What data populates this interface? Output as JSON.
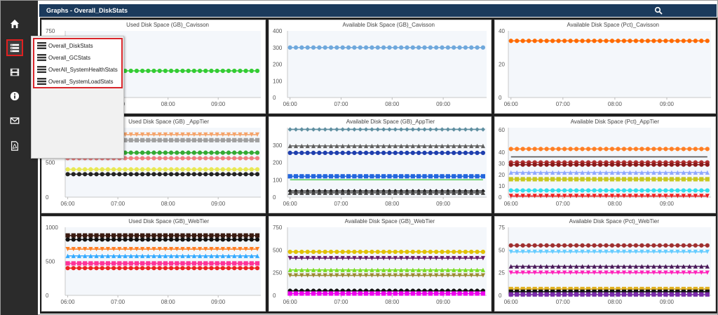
{
  "header": {
    "title": "Graphs - Overall_DiskStats",
    "search_icon": "search-icon"
  },
  "sidebar": {
    "items": [
      {
        "name": "home",
        "icon": "home-icon"
      },
      {
        "name": "graphs",
        "icon": "graph-list-icon",
        "selected": true
      },
      {
        "name": "media",
        "icon": "film-icon"
      },
      {
        "name": "info",
        "icon": "info-icon"
      },
      {
        "name": "mail",
        "icon": "mail-icon"
      },
      {
        "name": "pdf",
        "icon": "pdf-icon"
      }
    ]
  },
  "menu": {
    "items": [
      {
        "label": "Overall_DiskStats"
      },
      {
        "label": "Overall_GCStats"
      },
      {
        "label": "OverAll_SystemHealthStats"
      },
      {
        "label": "Overall_SystemLoadStats"
      }
    ]
  },
  "x_ticks": [
    "06:00",
    "07:00",
    "08:00",
    "09:00"
  ],
  "colors": {
    "sidebar_bg": "#2b2b2b",
    "header_bg": "#1b3a5c",
    "menu_border": "#d8262c"
  },
  "chart_data": [
    {
      "type": "line",
      "title": "Used Disk Space (GB)_Cavisson",
      "ylim": [
        0,
        750
      ],
      "y_ticks": [
        "750"
      ],
      "series": [
        {
          "values": [
            300
          ],
          "color": "#33cc33",
          "marker": "circle"
        }
      ]
    },
    {
      "type": "line",
      "title": "Available Disk Space (GB)_Cavisson",
      "ylim": [
        0,
        400
      ],
      "y_ticks": [
        "0",
        "100",
        "200",
        "300",
        "400"
      ],
      "series": [
        {
          "values": [
            300
          ],
          "color": "#6fa8dc",
          "marker": "circle"
        }
      ]
    },
    {
      "type": "line",
      "title": "Available Disk Space (Pct)_Cavisson",
      "ylim": [
        0,
        40
      ],
      "y_ticks": [
        "0",
        "20",
        "40"
      ],
      "series": [
        {
          "values": [
            34
          ],
          "color": "#ff6a00",
          "marker": "circle"
        }
      ]
    },
    {
      "type": "line",
      "title": "Used Disk Space (GB) _AppTier",
      "ylim": [
        0,
        1000
      ],
      "y_ticks": [
        "0",
        "500"
      ],
      "series": [
        {
          "values": [
            900
          ],
          "color": "#f5a36a",
          "marker": "triangle-down"
        },
        {
          "values": [
            820
          ],
          "color": "#a0a0a0",
          "marker": "square"
        },
        {
          "values": [
            640
          ],
          "color": "#33aa33",
          "marker": "circle"
        },
        {
          "values": [
            560
          ],
          "color": "#f08080",
          "marker": "circle"
        },
        {
          "values": [
            400
          ],
          "color": "#e8e855",
          "marker": "circle"
        },
        {
          "values": [
            330
          ],
          "color": "#222222",
          "marker": "circle"
        }
      ]
    },
    {
      "type": "line",
      "title": "Available Disk Space (GB)_AppTier",
      "ylim": [
        0,
        400
      ],
      "y_ticks": [
        "0",
        "100",
        "200",
        "300"
      ],
      "series": [
        {
          "values": [
            390
          ],
          "color": "#5f8fa0",
          "marker": "diamond"
        },
        {
          "values": [
            295
          ],
          "color": "#606060",
          "marker": "triangle"
        },
        {
          "values": [
            255
          ],
          "color": "#1f3fae",
          "marker": "circle"
        },
        {
          "values": [
            120
          ],
          "color": "#2266dd",
          "marker": "square"
        },
        {
          "values": [
            100
          ],
          "color": "#55cc55",
          "marker": "none"
        },
        {
          "values": [
            35
          ],
          "color": "#222222",
          "marker": "diamond"
        },
        {
          "values": [
            25
          ],
          "color": "#444444",
          "marker": "triangle"
        }
      ]
    },
    {
      "type": "line",
      "title": "Available Disk Space (Pct)_AppTier",
      "ylim": [
        0,
        62
      ],
      "y_ticks": [
        "0",
        "10",
        "20",
        "30",
        "40",
        "60"
      ],
      "series": [
        {
          "values": [
            43
          ],
          "color": "#ff7f24",
          "marker": "circle"
        },
        {
          "values": [
            36
          ],
          "color": "#555555",
          "marker": "none"
        },
        {
          "values": [
            31
          ],
          "color": "#b03030",
          "marker": "circle"
        },
        {
          "values": [
            29
          ],
          "color": "#8b1a1a",
          "marker": "circle"
        },
        {
          "values": [
            22
          ],
          "color": "#8fa8ff",
          "marker": "triangle"
        },
        {
          "values": [
            16
          ],
          "color": "#c8c820",
          "marker": "square"
        },
        {
          "values": [
            6
          ],
          "color": "#33ddee",
          "marker": "circle"
        },
        {
          "values": [
            1
          ],
          "color": "#ee2222",
          "marker": "triangle-down"
        }
      ]
    },
    {
      "type": "line",
      "title": "Used Disk Space (GB)_WebTier",
      "ylim": [
        0,
        1000
      ],
      "y_ticks": [
        "0",
        "500",
        "1000"
      ],
      "series": [
        {
          "values": [
            880
          ],
          "color": "#3a1a10",
          "marker": "square"
        },
        {
          "values": [
            820
          ],
          "color": "#111111",
          "marker": "circle"
        },
        {
          "values": [
            680
          ],
          "color": "#ff7f24",
          "marker": "triangle-down"
        },
        {
          "values": [
            580
          ],
          "color": "#33aaff",
          "marker": "triangle"
        },
        {
          "values": [
            470
          ],
          "color": "#ff3399",
          "marker": "square"
        },
        {
          "values": [
            400
          ],
          "color": "#ee2222",
          "marker": "circle"
        }
      ]
    },
    {
      "type": "line",
      "title": "Available Disk Space (GB)_WebTier",
      "ylim": [
        0,
        750
      ],
      "y_ticks": [
        "0",
        "250",
        "500",
        "750"
      ],
      "series": [
        {
          "values": [
            480
          ],
          "color": "#e0c000",
          "marker": "circle"
        },
        {
          "values": [
            410
          ],
          "color": "#6a1a6a",
          "marker": "triangle-down"
        },
        {
          "values": [
            280
          ],
          "color": "#77dd22",
          "marker": "triangle"
        },
        {
          "values": [
            220
          ],
          "color": "#9a8a30",
          "marker": "triangle-down"
        },
        {
          "values": [
            50
          ],
          "color": "#111111",
          "marker": "circle"
        },
        {
          "values": [
            20
          ],
          "color": "#ee00ee",
          "marker": "square"
        }
      ]
    },
    {
      "type": "line",
      "title": "Available Disk Space (Pct)_WebTier",
      "ylim": [
        0,
        75
      ],
      "y_ticks": [
        "0",
        "25",
        "50",
        "75"
      ],
      "series": [
        {
          "values": [
            55
          ],
          "color": "#a03030",
          "marker": "circle"
        },
        {
          "values": [
            48
          ],
          "color": "#66ccff",
          "marker": "triangle-down"
        },
        {
          "values": [
            32
          ],
          "color": "#4a1a5a",
          "marker": "triangle"
        },
        {
          "values": [
            25
          ],
          "color": "#ff22bb",
          "marker": "triangle-down"
        },
        {
          "values": [
            7
          ],
          "color": "#e0b020",
          "marker": "square"
        },
        {
          "values": [
            4
          ],
          "color": "#111111",
          "marker": "square"
        },
        {
          "values": [
            1
          ],
          "color": "#7a2aaa",
          "marker": "square"
        }
      ]
    }
  ]
}
